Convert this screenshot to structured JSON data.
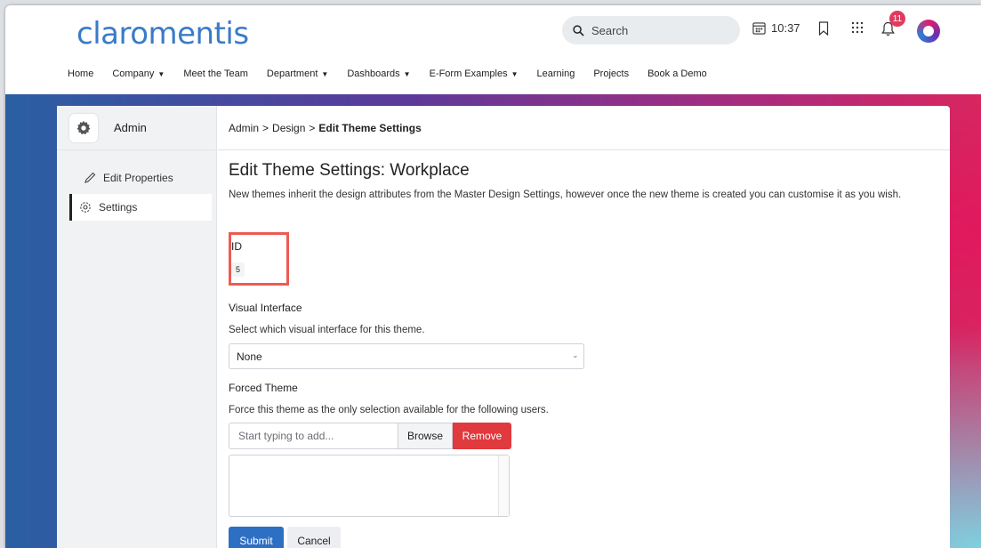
{
  "header": {
    "logo": "claromentis",
    "search_placeholder": "Search",
    "time": "10:37",
    "notification_count": "11"
  },
  "nav": [
    {
      "label": "Home",
      "dropdown": false
    },
    {
      "label": "Company",
      "dropdown": true
    },
    {
      "label": "Meet the Team",
      "dropdown": false
    },
    {
      "label": "Department",
      "dropdown": true
    },
    {
      "label": "Dashboards",
      "dropdown": true
    },
    {
      "label": "E-Form Examples",
      "dropdown": true
    },
    {
      "label": "Learning",
      "dropdown": false
    },
    {
      "label": "Projects",
      "dropdown": false
    },
    {
      "label": "Book a Demo",
      "dropdown": false
    }
  ],
  "sidebar": {
    "title": "Admin",
    "items": [
      {
        "label": "Edit Properties",
        "icon": "pencil-icon",
        "active": false
      },
      {
        "label": "Settings",
        "icon": "gear-icon",
        "active": true
      }
    ]
  },
  "breadcrumb": {
    "items": [
      "Admin",
      "Design"
    ],
    "current": "Edit Theme Settings",
    "separator": ">"
  },
  "form": {
    "title": "Edit Theme Settings: Workplace",
    "description": "New themes inherit the design attributes from the Master Design Settings, however once the new theme is created you can customise it as you wish.",
    "id_label": "ID",
    "id_value": "5",
    "visual_label": "Visual Interface",
    "visual_help": "Select which visual interface for this theme.",
    "visual_value": "None",
    "forced_label": "Forced Theme",
    "forced_help": "Force this theme as the only selection available for the following users.",
    "picker_placeholder": "Start typing to add...",
    "browse_label": "Browse",
    "remove_label": "Remove",
    "submit_label": "Submit",
    "cancel_label": "Cancel"
  },
  "colors": {
    "brand": "#3a7bc8",
    "primary": "#2d6fc2",
    "danger": "#e0393e",
    "highlight": "#ee5a52",
    "badge": "#e03a5f"
  }
}
